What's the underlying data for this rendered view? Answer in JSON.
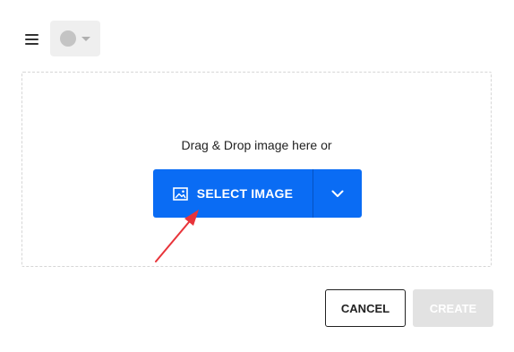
{
  "header": {
    "menu_icon": "hamburger-menu-icon",
    "account_selector": {
      "avatar_icon": "avatar-placeholder-icon",
      "caret_icon": "caret-down-icon"
    }
  },
  "dropzone": {
    "prompt": "Drag & Drop image here or",
    "select_button": {
      "label": "SELECT IMAGE",
      "icon": "image-icon",
      "dropdown_icon": "chevron-down-icon",
      "color": "#0a6cf4"
    }
  },
  "footer": {
    "cancel_label": "CANCEL",
    "create_label": "CREATE",
    "create_disabled": true
  },
  "annotation": {
    "arrow_color": "#e8343a"
  }
}
